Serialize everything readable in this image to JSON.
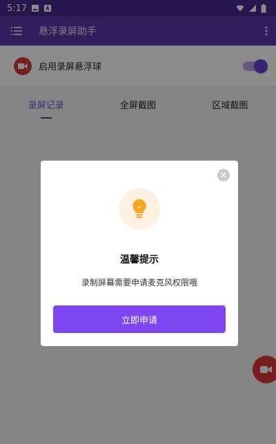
{
  "status_bar": {
    "time": "5:17"
  },
  "app_bar": {
    "title": "悬浮录屏助手"
  },
  "floating_toggle": {
    "label": "启用录屏悬浮球",
    "enabled": true
  },
  "tabs": [
    {
      "label": "录屏记录",
      "active": true
    },
    {
      "label": "全屏截图",
      "active": false
    },
    {
      "label": "区域截图",
      "active": false
    }
  ],
  "dialog": {
    "title": "温馨提示",
    "message": "录制屏幕需要申请麦克风权限哦",
    "button_label": "立即申请",
    "icon": "lightbulb-icon"
  },
  "colors": {
    "status_bar_bg": "#4a2b8f",
    "app_bar_bg": "#5b36a9",
    "accent": "#7e45f0",
    "record_red": "#d9383a",
    "bulb_orange": "#f5a623"
  }
}
